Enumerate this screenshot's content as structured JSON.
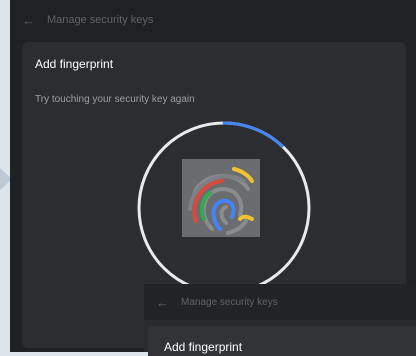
{
  "main_window": {
    "title": "Manage security keys",
    "dialog": {
      "title": "Add fingerprint",
      "message": "Try touching your security key again",
      "progress_fraction": 0.12
    }
  },
  "front_window": {
    "title": "Manage security keys",
    "dialog": {
      "title": "Add fingerprint"
    }
  },
  "colors": {
    "window_bg": "#202124",
    "card_bg": "#2b2d31",
    "progress_accent": "#4285f4",
    "ring": "#e8eaed"
  },
  "icons": [
    "back-arrow-icon",
    "fingerprint-icon"
  ]
}
